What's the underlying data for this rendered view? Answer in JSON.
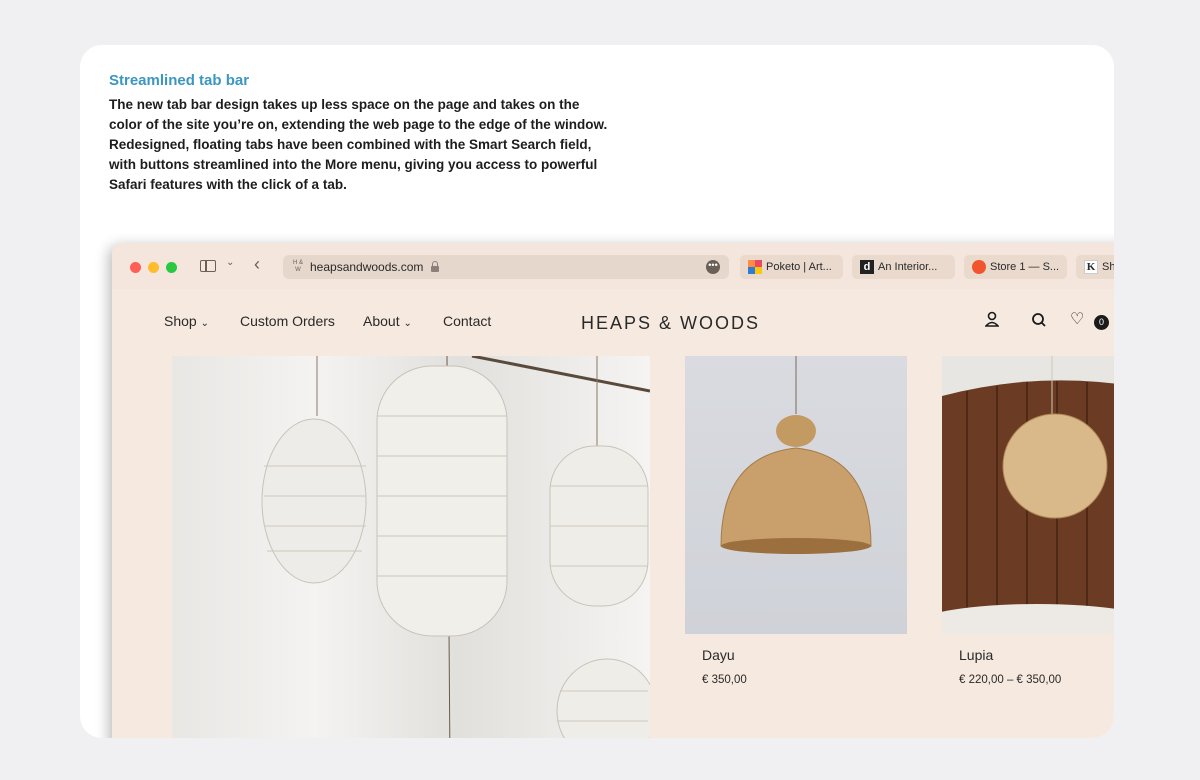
{
  "caption": {
    "title": "Streamlined tab bar",
    "body": "The new tab bar design takes up less space on the page and takes on the color of the site you’re on, extending the web page to the edge of the window. Redesigned, floating tabs have been combined with the Smart Search field, with buttons streamlined into the More menu, giving you access to powerful Safari features with the click of a tab."
  },
  "browser": {
    "address": {
      "url": "heapsandwoods.com",
      "favicon_text": "H & W"
    },
    "tabs": [
      {
        "label": "Poketo | Art...",
        "icon": "poketo-favicon"
      },
      {
        "label": "An Interior...",
        "icon": "d-favicon",
        "icon_text": "d"
      },
      {
        "label": "Store 1 — S...",
        "icon": "store-favicon"
      },
      {
        "label": "Sh",
        "icon": "k-favicon",
        "icon_text": "K"
      }
    ]
  },
  "site": {
    "nav": {
      "shop": "Shop",
      "custom_orders": "Custom Orders",
      "about": "About",
      "contact": "Contact",
      "chevron": "⌄"
    },
    "logo": "HEAPS & WOODS",
    "cart_count": "0",
    "products": [
      {
        "name": "Dayu",
        "price": "€ 350,00"
      },
      {
        "name": "Lupia",
        "price": "€ 220,00 – € 350,00"
      }
    ]
  },
  "colors": {
    "accent": "#3a97c0",
    "site_bg": "#f6e9df"
  }
}
